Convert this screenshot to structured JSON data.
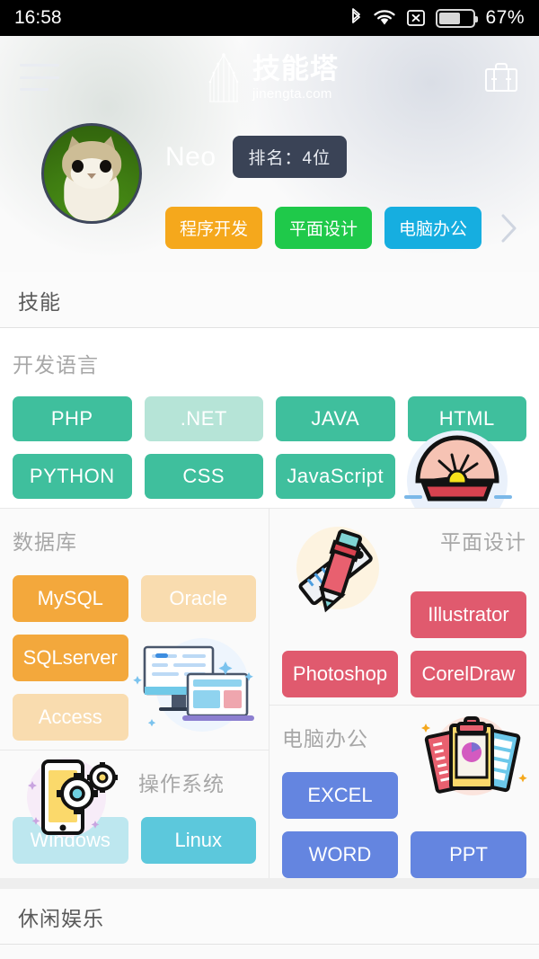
{
  "statusbar": {
    "time": "16:58",
    "battery_pct": "67%",
    "icons": [
      "bluetooth-icon",
      "wifi-icon",
      "no-sim-icon",
      "battery-icon"
    ]
  },
  "header": {
    "menu_icon": "hamburger-menu-icon",
    "logo_cn": "技能塔",
    "logo_en": "jinengta.com",
    "logo_icon": "tower-logo-icon",
    "briefcase_icon": "briefcase-icon"
  },
  "profile": {
    "avatar_alt": "cat-avatar",
    "username": "Neo",
    "rank_label": "排名：4位",
    "tags": [
      {
        "label": "程序开发",
        "color": "#F5A81C"
      },
      {
        "label": "平面设计",
        "color": "#1FC94A"
      },
      {
        "label": "电脑办公",
        "color": "#16AEE0"
      }
    ],
    "more_icon": "chevron-right-icon"
  },
  "skills": {
    "section_title": "技能",
    "languages": {
      "title": "开发语言",
      "active_color": "#3FBF9D",
      "faded_color": "#B6E4D7",
      "items": [
        {
          "label": "PHP",
          "active": true
        },
        {
          "label": ".NET",
          "active": false
        },
        {
          "label": "JAVA",
          "active": true
        },
        {
          "label": "HTML",
          "active": true
        },
        {
          "label": "PYTHON",
          "active": true
        },
        {
          "label": "CSS",
          "active": true
        },
        {
          "label": "JavaScript",
          "active": true
        }
      ],
      "illustration": "seashell-pearl-illustration"
    },
    "database": {
      "title": "数据库",
      "active_color": "#F3A83C",
      "faded_color": "#F9DCAF",
      "items": [
        {
          "label": "MySQL",
          "active": true
        },
        {
          "label": "Oracle",
          "active": false
        },
        {
          "label": "SQLserver",
          "active": true
        },
        {
          "label": "Access",
          "active": false
        }
      ],
      "illustration": "desktop-laptop-illustration"
    },
    "design": {
      "title": "平面设计",
      "active_color": "#E05A6E",
      "items": [
        {
          "label": "Illustrator",
          "active": true
        },
        {
          "label": "Photoshop",
          "active": true
        },
        {
          "label": "CorelDraw",
          "active": true
        }
      ],
      "illustration": "pencil-ruler-illustration"
    },
    "os": {
      "title": "操作系统",
      "active_color": "#5CC8DC",
      "faded_color": "#BDE7EF",
      "items": [
        {
          "label": "Windows",
          "active": false
        },
        {
          "label": "Linux",
          "active": true
        }
      ],
      "illustration": "phone-gears-illustration"
    },
    "office": {
      "title": "电脑办公",
      "active_color": "#6485E0",
      "items": [
        {
          "label": "EXCEL",
          "active": true
        },
        {
          "label": "WORD",
          "active": true
        },
        {
          "label": "PPT",
          "active": true
        }
      ],
      "illustration": "clipboard-chart-illustration"
    }
  },
  "leisure": {
    "section_title": "休闲娱乐"
  }
}
